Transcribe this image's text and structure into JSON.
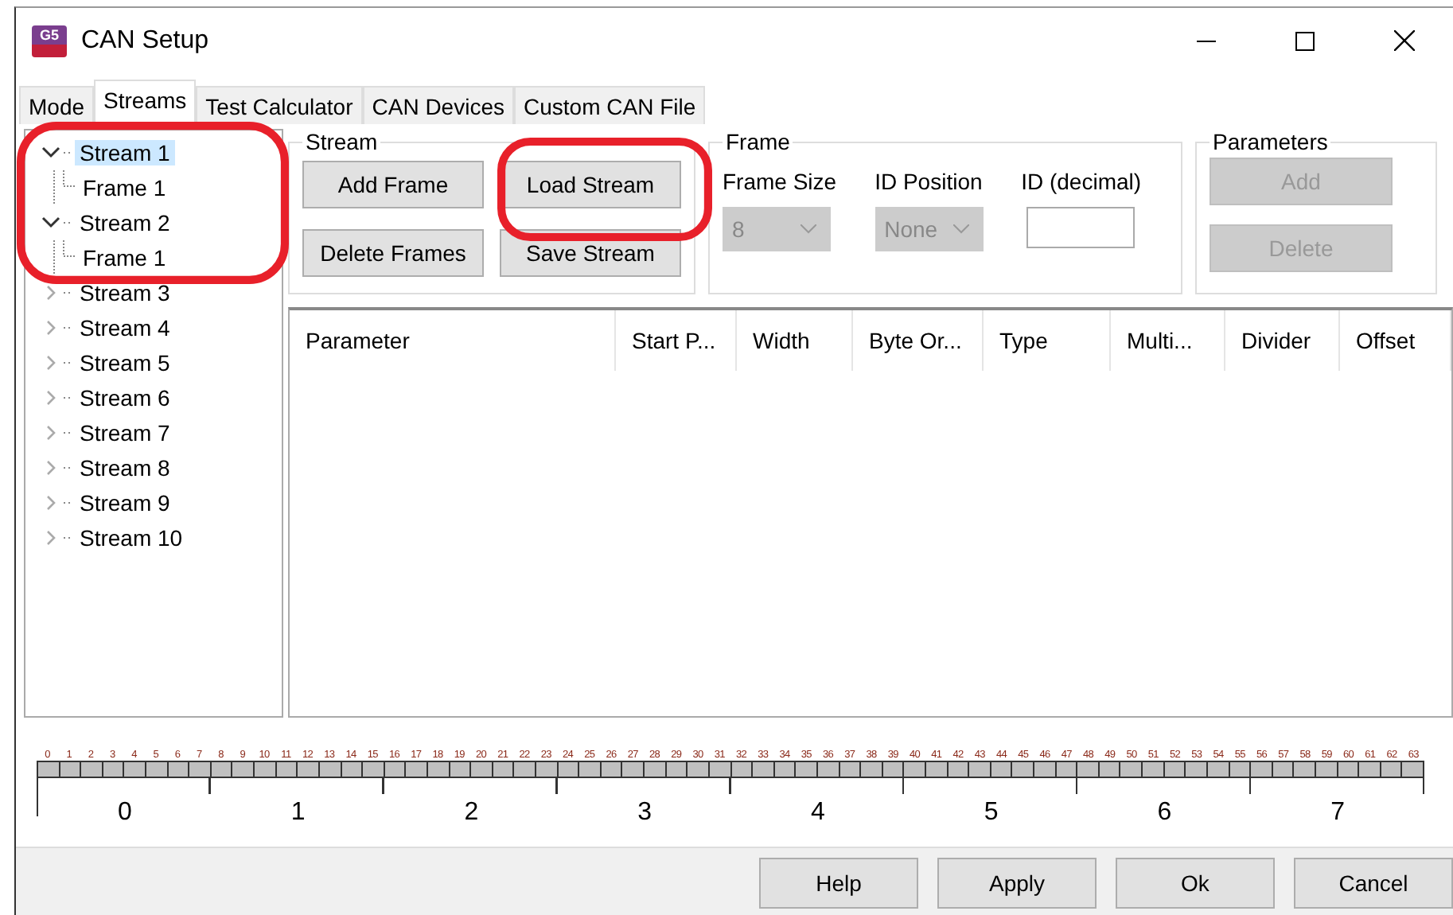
{
  "window": {
    "title": "CAN Setup",
    "logo": "G5"
  },
  "tabs": [
    {
      "label": "Mode",
      "selected": false
    },
    {
      "label": "Streams",
      "selected": true
    },
    {
      "label": "Test Calculator",
      "selected": false
    },
    {
      "label": "CAN Devices",
      "selected": false
    },
    {
      "label": "Custom CAN File",
      "selected": false
    }
  ],
  "tree": [
    {
      "label": "Stream 1",
      "expanded": true,
      "selected": true,
      "children": [
        {
          "label": "Frame 1",
          "selected": false
        }
      ]
    },
    {
      "label": "Stream 2",
      "expanded": true,
      "selected": false,
      "children": [
        {
          "label": "Frame 1",
          "selected": false
        }
      ]
    },
    {
      "label": "Stream 3",
      "expanded": false,
      "selected": false
    },
    {
      "label": "Stream 4",
      "expanded": false,
      "selected": false
    },
    {
      "label": "Stream 5",
      "expanded": false,
      "selected": false
    },
    {
      "label": "Stream 6",
      "expanded": false,
      "selected": false
    },
    {
      "label": "Stream 7",
      "expanded": false,
      "selected": false
    },
    {
      "label": "Stream 8",
      "expanded": false,
      "selected": false
    },
    {
      "label": "Stream 9",
      "expanded": false,
      "selected": false
    },
    {
      "label": "Stream 10",
      "expanded": false,
      "selected": false
    }
  ],
  "stream_group": {
    "title": "Stream",
    "buttons": [
      {
        "label": "Add Frame",
        "disabled": false
      },
      {
        "label": "Load Stream",
        "disabled": false
      },
      {
        "label": "Delete Frames",
        "disabled": false
      },
      {
        "label": "Save Stream",
        "disabled": false
      }
    ]
  },
  "frame_group": {
    "title": "Frame",
    "frame_size": {
      "label": "Frame Size",
      "value": "8",
      "disabled": true
    },
    "id_position": {
      "label": "ID Position",
      "value": "None",
      "disabled": true
    },
    "id_decimal": {
      "label": "ID (decimal)"
    }
  },
  "parameters_group": {
    "title": "Parameters",
    "buttons": [
      {
        "label": "Add",
        "disabled": true
      },
      {
        "label": "Delete",
        "disabled": true
      }
    ]
  },
  "table": {
    "columns": [
      "Parameter",
      "Start P...",
      "Width",
      "Byte Or...",
      "Type",
      "Multi...",
      "Divider",
      "Offset"
    ]
  },
  "bit_ruler": {
    "bits": [
      "0",
      "1",
      "2",
      "3",
      "4",
      "5",
      "6",
      "7",
      "8",
      "9",
      "10",
      "11",
      "12",
      "13",
      "14",
      "15",
      "16",
      "17",
      "18",
      "19",
      "20",
      "21",
      "22",
      "23",
      "24",
      "25",
      "26",
      "27",
      "28",
      "29",
      "30",
      "31",
      "32",
      "33",
      "34",
      "35",
      "36",
      "37",
      "38",
      "39",
      "40",
      "41",
      "42",
      "43",
      "44",
      "45",
      "46",
      "47",
      "48",
      "49",
      "50",
      "51",
      "52",
      "53",
      "54",
      "55",
      "56",
      "57",
      "58",
      "59",
      "60",
      "61",
      "62",
      "63"
    ],
    "bytes": [
      "0",
      "1",
      "2",
      "3",
      "4",
      "5",
      "6",
      "7"
    ]
  },
  "footer_buttons": [
    "Help",
    "Apply",
    "Ok",
    "Cancel"
  ]
}
